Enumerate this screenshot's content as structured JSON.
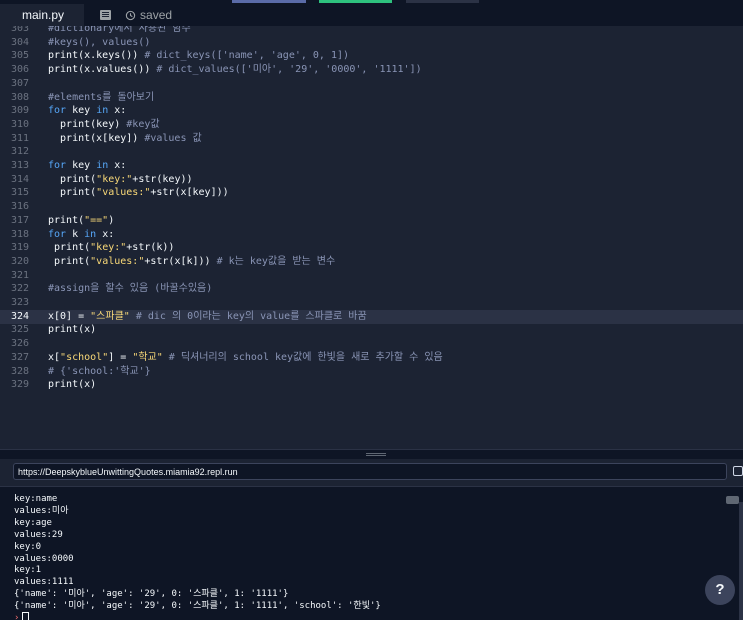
{
  "tabs": {
    "file_label": "main.py",
    "status_label": "saved",
    "icons": [
      "file-tab-icon",
      "history-icon"
    ]
  },
  "editor": {
    "active_line": "324",
    "lines": [
      {
        "n": "303",
        "parts": [
          [
            "c",
            "#dictionary에서 사용된 함수"
          ]
        ]
      },
      {
        "n": "304",
        "parts": [
          [
            "c",
            "#keys(), values()"
          ]
        ]
      },
      {
        "n": "305",
        "parts": [
          [
            "f",
            "print(x.keys()) "
          ],
          [
            "c",
            "# dict_keys(['name', 'age', 0, 1])"
          ]
        ]
      },
      {
        "n": "306",
        "parts": [
          [
            "f",
            "print(x.values()) "
          ],
          [
            "c",
            "# dict_values(['미아', '29', '0000', '1111'])"
          ]
        ]
      },
      {
        "n": "307",
        "parts": []
      },
      {
        "n": "308",
        "parts": [
          [
            "c",
            "#elements를 돌아보기"
          ]
        ]
      },
      {
        "n": "309",
        "parts": [
          [
            "k",
            "for "
          ],
          [
            "f",
            "key "
          ],
          [
            "k",
            "in "
          ],
          [
            "f",
            "x:"
          ]
        ]
      },
      {
        "n": "310",
        "parts": [
          [
            "f",
            "  print(key) "
          ],
          [
            "c",
            "#key값"
          ]
        ]
      },
      {
        "n": "311",
        "parts": [
          [
            "f",
            "  print(x[key]) "
          ],
          [
            "c",
            "#values 값"
          ]
        ]
      },
      {
        "n": "312",
        "parts": []
      },
      {
        "n": "313",
        "parts": [
          [
            "k",
            "for "
          ],
          [
            "f",
            "key "
          ],
          [
            "k",
            "in "
          ],
          [
            "f",
            "x:"
          ]
        ]
      },
      {
        "n": "314",
        "parts": [
          [
            "f",
            "  print("
          ],
          [
            "s",
            "\"key:\""
          ],
          [
            "f",
            "+str(key))"
          ]
        ]
      },
      {
        "n": "315",
        "parts": [
          [
            "f",
            "  print("
          ],
          [
            "s",
            "\"values:\""
          ],
          [
            "f",
            "+str(x[key]))"
          ]
        ]
      },
      {
        "n": "316",
        "parts": []
      },
      {
        "n": "317",
        "parts": [
          [
            "f",
            "print("
          ],
          [
            "s",
            "\"==\""
          ],
          [
            "f",
            ")"
          ]
        ]
      },
      {
        "n": "318",
        "parts": [
          [
            "k",
            "for "
          ],
          [
            "f",
            "k "
          ],
          [
            "k",
            "in "
          ],
          [
            "f",
            "x:"
          ]
        ]
      },
      {
        "n": "319",
        "parts": [
          [
            "f",
            " print("
          ],
          [
            "s",
            "\"key:\""
          ],
          [
            "f",
            "+str(k))"
          ]
        ]
      },
      {
        "n": "320",
        "parts": [
          [
            "f",
            " print("
          ],
          [
            "s",
            "\"values:\""
          ],
          [
            "f",
            "+str(x[k])) "
          ],
          [
            "c",
            "# k는 key값을 받는 변수"
          ]
        ]
      },
      {
        "n": "321",
        "parts": []
      },
      {
        "n": "322",
        "parts": [
          [
            "c",
            "#assign을 할수 있음 (바꿀수있음)"
          ]
        ]
      },
      {
        "n": "323",
        "parts": []
      },
      {
        "n": "324",
        "parts": [
          [
            "f",
            "x[0] = "
          ],
          [
            "s",
            "\"스파클\" "
          ],
          [
            "c",
            "# dic 의 0이라는 key의 value를 스파클로 바꿈"
          ]
        ]
      },
      {
        "n": "325",
        "parts": [
          [
            "f",
            "print(x)"
          ]
        ]
      },
      {
        "n": "326",
        "parts": []
      },
      {
        "n": "327",
        "parts": [
          [
            "f",
            "x["
          ],
          [
            "s",
            "\"school\""
          ],
          [
            "f",
            "] = "
          ],
          [
            "s",
            "\"학교\" "
          ],
          [
            "c",
            "# 딕셔너리의 school key값에 한빛을 새로 추가할 수 있음"
          ]
        ]
      },
      {
        "n": "328",
        "parts": [
          [
            "c",
            "# {'school:'학교'}"
          ]
        ]
      },
      {
        "n": "329",
        "parts": [
          [
            "f",
            "print(x)"
          ]
        ]
      }
    ]
  },
  "url": {
    "value": "https://DeepskyblueUnwittingQuotes.miamia92.repl.run"
  },
  "console": {
    "lines": [
      "key:name",
      "values:미아",
      "key:age",
      "values:29",
      "key:0",
      "values:0000",
      "key:1",
      "values:1111",
      "{'name': '미아', 'age': '29', 0: '스파클', 1: '1111'}",
      "{'name': '미아', 'age': '29', 0: '스파클', 1: '1111', 'school': '한빛'}"
    ],
    "prompt": "›"
  },
  "help": {
    "label": "?"
  },
  "colors": {
    "editor_bg": "#1c2333",
    "console_bg": "#0e1525",
    "keyword": "#56a6f7",
    "string": "#f9d978",
    "comment": "#8a95b6",
    "accent_bar_1": "#5a6ba8",
    "accent_bar_2": "#2ec27e"
  }
}
